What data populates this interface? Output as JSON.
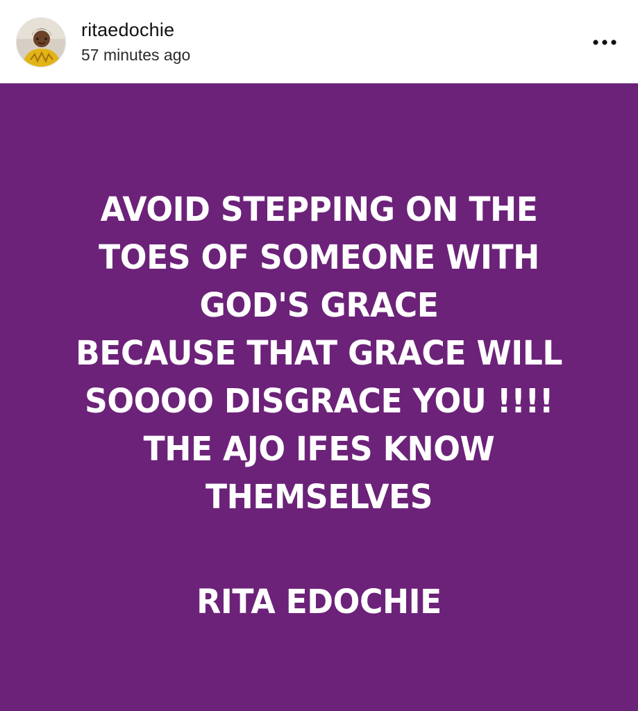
{
  "header": {
    "username": "ritaedochie",
    "timestamp": "57 minutes ago",
    "avatar_icon": "profile-photo",
    "more_icon": "more-horizontal-icon"
  },
  "post": {
    "background_color": "#6c2279",
    "text_color": "#ffffff",
    "quote_lines": [
      "AVOID STEPPING ON THE",
      "TOES OF SOMEONE WITH",
      "GOD'S GRACE",
      "BECAUSE THAT GRACE WILL",
      "SOOOO DISGRACE YOU !!!!",
      "THE AJO IFES KNOW",
      "THEMSELVES"
    ],
    "signature": "RITA EDOCHIE"
  }
}
